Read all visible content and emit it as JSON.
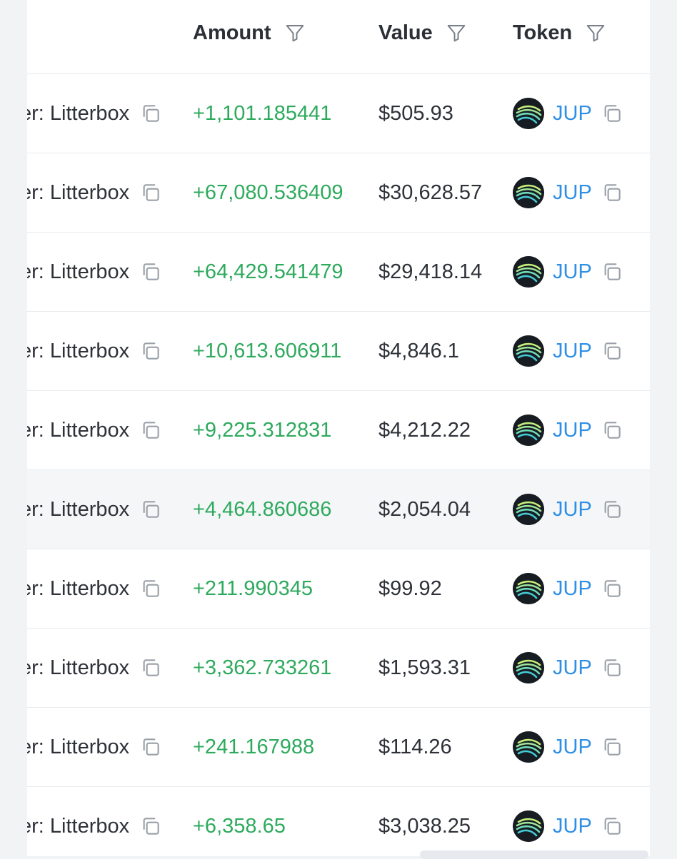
{
  "columns": {
    "amount": "Amount",
    "value": "Value",
    "token": "Token"
  },
  "icons": {
    "filter": "filter-funnel-icon",
    "copy": "copy-icon",
    "token_logo": "jup-logo-icon"
  },
  "colors": {
    "positive": "#2eaa5d",
    "link": "#2f8fe6",
    "text": "#2e3238"
  },
  "rows": [
    {
      "from": "er: Litterbox",
      "amount": "+1,101.185441",
      "value": "$505.93",
      "token": "JUP"
    },
    {
      "from": "er: Litterbox",
      "amount": "+67,080.536409",
      "value": "$30,628.57",
      "token": "JUP"
    },
    {
      "from": "er: Litterbox",
      "amount": "+64,429.541479",
      "value": "$29,418.14",
      "token": "JUP"
    },
    {
      "from": "er: Litterbox",
      "amount": "+10,613.606911",
      "value": "$4,846.1",
      "token": "JUP"
    },
    {
      "from": "er: Litterbox",
      "amount": "+9,225.312831",
      "value": "$4,212.22",
      "token": "JUP"
    },
    {
      "from": "er: Litterbox",
      "amount": "+4,464.860686",
      "value": "$2,054.04",
      "token": "JUP"
    },
    {
      "from": "er: Litterbox",
      "amount": "+211.990345",
      "value": "$99.92",
      "token": "JUP"
    },
    {
      "from": "er: Litterbox",
      "amount": "+3,362.733261",
      "value": "$1,593.31",
      "token": "JUP"
    },
    {
      "from": "er: Litterbox",
      "amount": "+241.167988",
      "value": "$114.26",
      "token": "JUP"
    },
    {
      "from": "er: Litterbox",
      "amount": "+6,358.65",
      "value": "$3,038.25",
      "token": "JUP"
    }
  ]
}
